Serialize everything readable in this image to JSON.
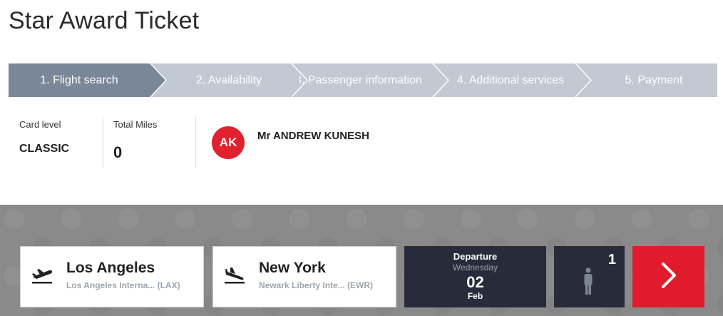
{
  "page": {
    "title": "Star Award Ticket"
  },
  "stepper": {
    "steps": [
      {
        "label": "1. Flight search",
        "active": true
      },
      {
        "label": "2. Availability",
        "active": false
      },
      {
        "label": "3. Passenger information",
        "active": false
      },
      {
        "label": "4. Additional services",
        "active": false
      },
      {
        "label": "5. Payment",
        "active": false
      }
    ]
  },
  "profile": {
    "card_level_label": "Card level",
    "card_level_value": "CLASSIC",
    "total_miles_label": "Total Miles",
    "total_miles_value": "0",
    "avatar_initials": "AK",
    "user_name": "Mr ANDREW KUNESH"
  },
  "search": {
    "origin": {
      "city": "Los Angeles",
      "airport": "Los Angeles Interna... (LAX)",
      "icon": "plane-takeoff-icon"
    },
    "destination": {
      "city": "New York",
      "airport": "Newark Liberty Inte... (EWR)",
      "icon": "plane-landing-icon"
    },
    "departure": {
      "label": "Departure",
      "weekday": "Wednesday",
      "day": "02",
      "month": "Feb"
    },
    "passengers": {
      "count": "1",
      "icon": "person-icon"
    },
    "go_icon": "chevron-right-icon"
  },
  "colors": {
    "active_step": "#7a8799",
    "inactive_step": "#c3c9d2",
    "brand_red": "#e01c2c",
    "dark_card": "#272b3a"
  }
}
